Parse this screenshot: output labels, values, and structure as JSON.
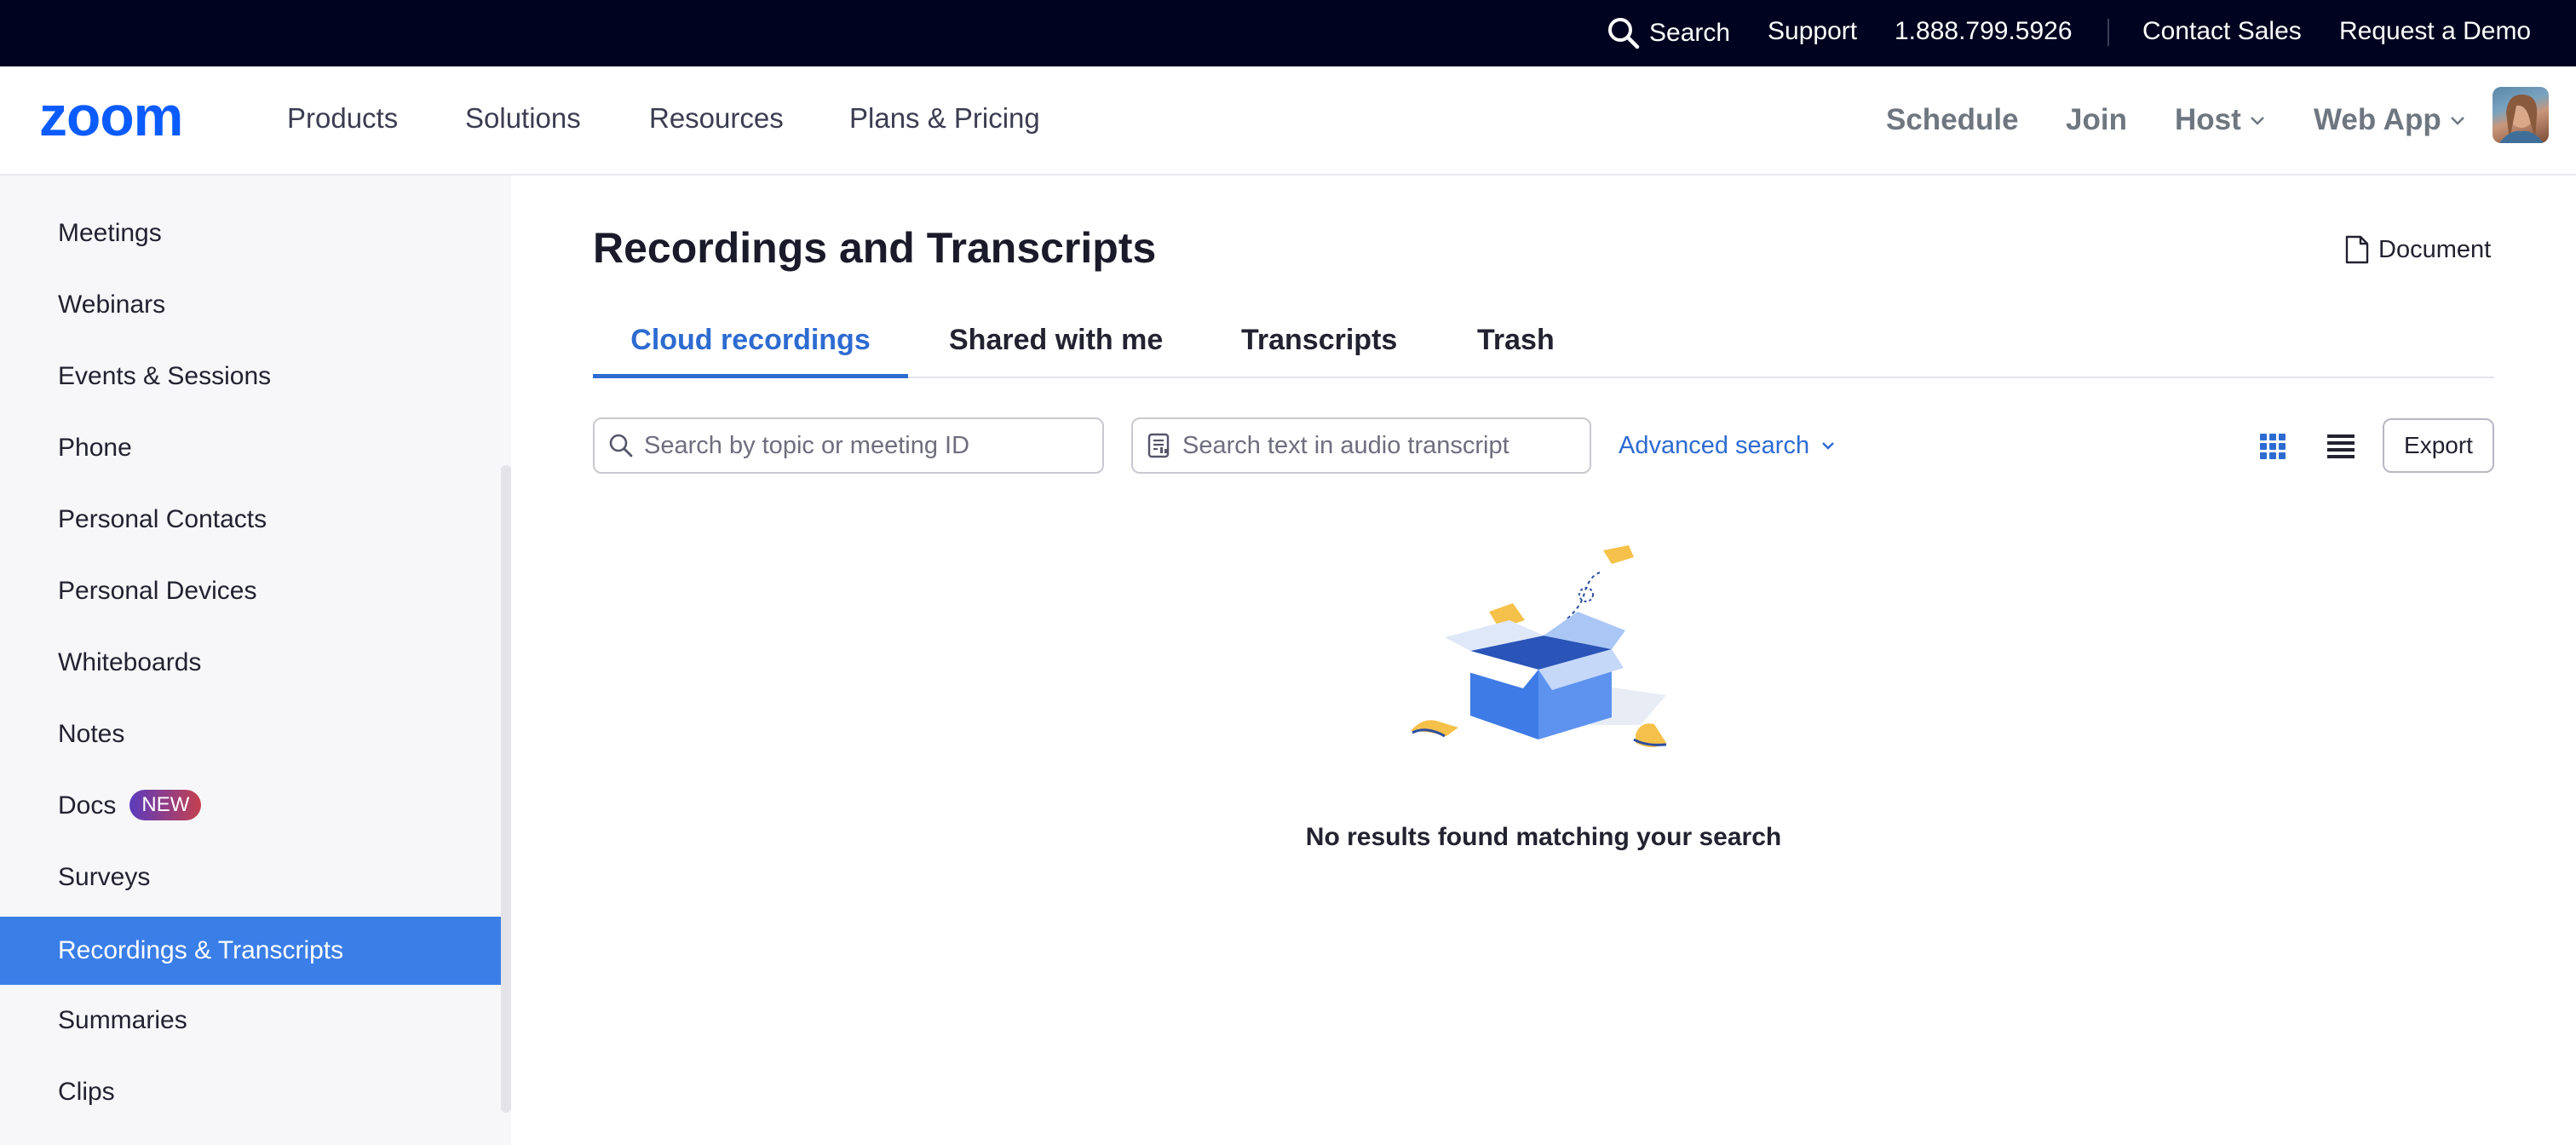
{
  "utility_bar": {
    "search_label": "Search",
    "support_label": "Support",
    "phone": "1.888.799.5926",
    "contact_sales_label": "Contact Sales",
    "request_demo_label": "Request a Demo"
  },
  "nav": {
    "logo_text": "zoom",
    "links": [
      "Products",
      "Solutions",
      "Resources",
      "Plans & Pricing"
    ],
    "right": {
      "schedule": "Schedule",
      "join": "Join",
      "host": "Host",
      "web_app": "Web App"
    }
  },
  "sidebar": {
    "items": [
      {
        "label": "Meetings"
      },
      {
        "label": "Webinars"
      },
      {
        "label": "Events & Sessions"
      },
      {
        "label": "Phone"
      },
      {
        "label": "Personal Contacts"
      },
      {
        "label": "Personal Devices"
      },
      {
        "label": "Whiteboards"
      },
      {
        "label": "Notes"
      },
      {
        "label": "Docs",
        "badge": "NEW"
      },
      {
        "label": "Surveys"
      },
      {
        "label": "Recordings & Transcripts",
        "active": true
      },
      {
        "label": "Summaries"
      },
      {
        "label": "Clips"
      }
    ]
  },
  "main": {
    "title": "Recordings and Transcripts",
    "document_label": "Document",
    "tabs": [
      {
        "label": "Cloud recordings",
        "active": true
      },
      {
        "label": "Shared with me"
      },
      {
        "label": "Transcripts"
      },
      {
        "label": "Trash"
      }
    ],
    "search_topic": {
      "placeholder": "Search by topic or meeting ID",
      "value": ""
    },
    "search_audio": {
      "placeholder": "Search text in audio transcript",
      "value": ""
    },
    "advanced_search_label": "Advanced search",
    "export_label": "Export",
    "view_mode": "grid",
    "empty_message": "No results found matching your search"
  },
  "colors": {
    "utility_bar_bg": "#00031f",
    "brand_blue": "#0b5cff",
    "active_sidebar": "#3a7ee8",
    "link_blue": "#2d6bd1"
  },
  "icons": [
    "search-icon",
    "chevron-down-icon",
    "document-icon",
    "transcript-icon",
    "grid-view-icon",
    "list-view-icon",
    "empty-box-illustration"
  ]
}
